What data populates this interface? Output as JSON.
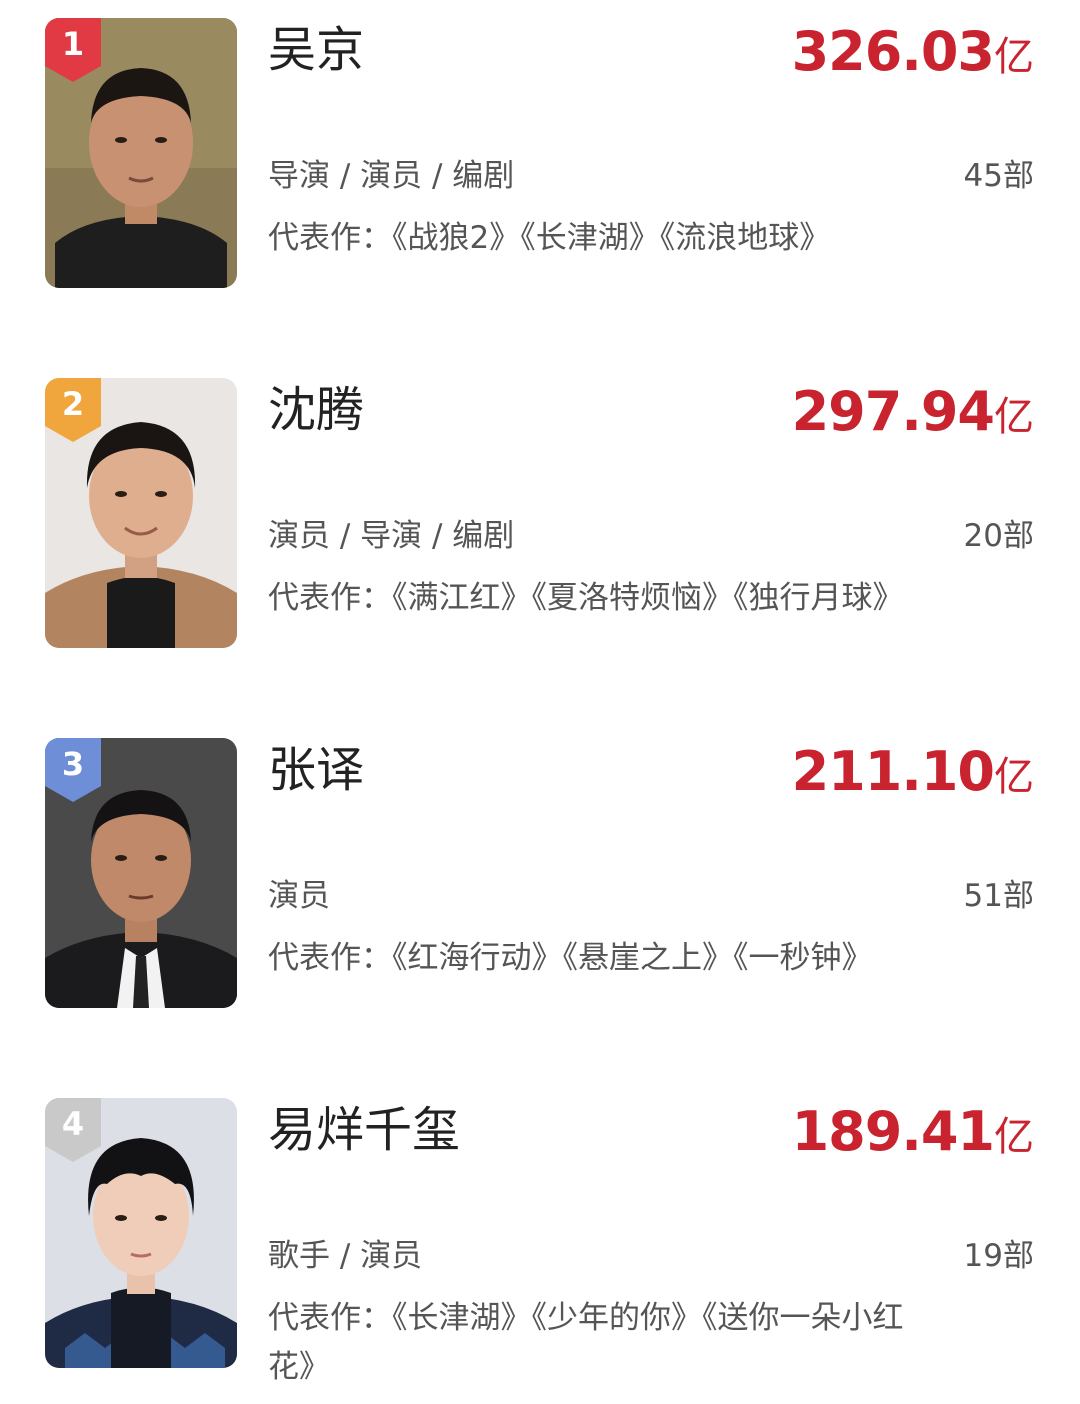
{
  "rankings": [
    {
      "rank": "1",
      "badge_color": "#e23a45",
      "name": "吴京",
      "box_office": "326.03",
      "box_unit": "亿",
      "roles": "导演 / 演员 / 编剧",
      "works_count": "45部",
      "representative": "代表作：《战狼2》《长津湖》《流浪地球》"
    },
    {
      "rank": "2",
      "badge_color": "#f0a63c",
      "name": "沈腾",
      "box_office": "297.94",
      "box_unit": "亿",
      "roles": "演员 / 导演 / 编剧",
      "works_count": "20部",
      "representative": "代表作：《满江红》《夏洛特烦恼》《独行月球》"
    },
    {
      "rank": "3",
      "badge_color": "#6f8ed8",
      "name": "张译",
      "box_office": "211.10",
      "box_unit": "亿",
      "roles": "演员",
      "works_count": "51部",
      "representative": "代表作：《红海行动》《悬崖之上》《一秒钟》"
    },
    {
      "rank": "4",
      "badge_color": "#c9c9c9",
      "name": "易烊千玺",
      "box_office": "189.41",
      "box_unit": "亿",
      "roles": "歌手 / 演员",
      "works_count": "19部",
      "representative": "代表作：《长津湖》《少年的你》《送你一朵小红花》"
    }
  ]
}
